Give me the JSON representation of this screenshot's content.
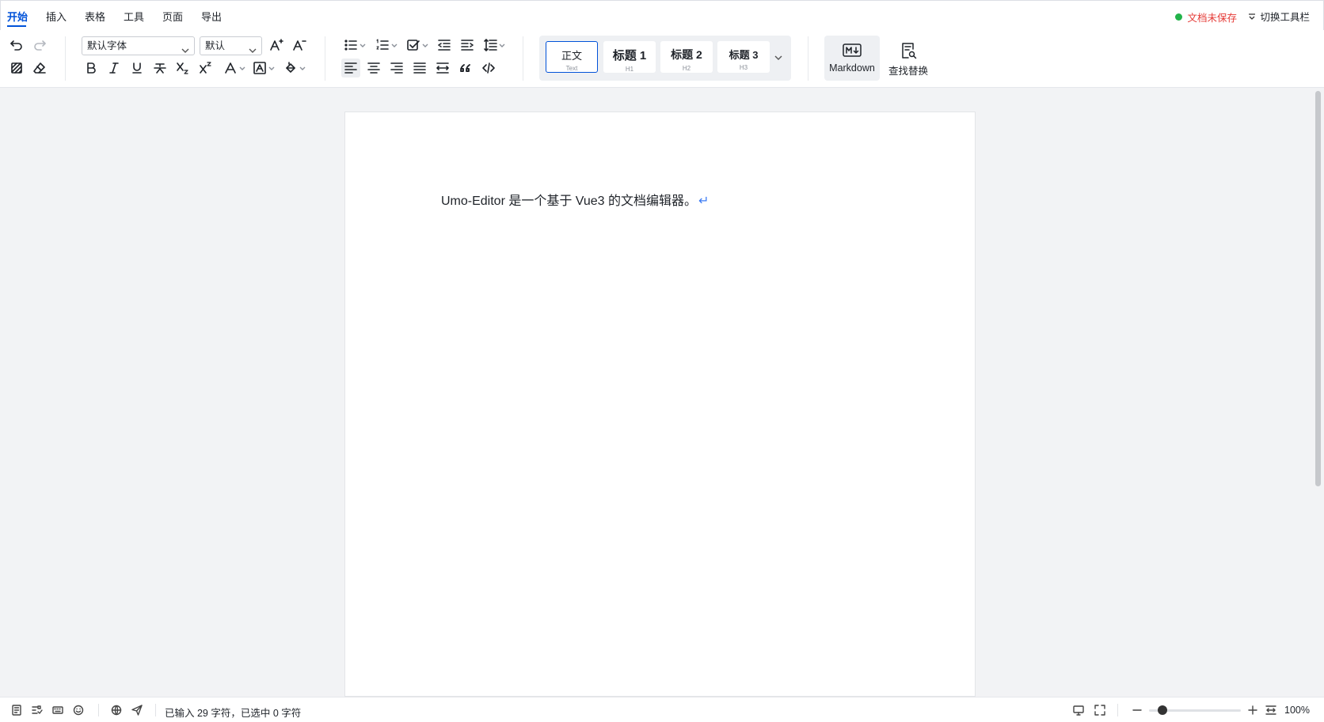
{
  "menu": {
    "tabs": [
      "开始",
      "插入",
      "表格",
      "工具",
      "页面",
      "导出"
    ],
    "active_tab": "开始",
    "save_status": "文档未保存",
    "toggle_toolbar": "切换工具栏"
  },
  "toolbar": {
    "font_family": "默认字体",
    "font_size": "默认",
    "styles": [
      {
        "main": "正文",
        "sub": "Text"
      },
      {
        "main": "标题 1",
        "sub": "H1"
      },
      {
        "main": "标题 2",
        "sub": "H2"
      },
      {
        "main": "标题 3",
        "sub": "H3"
      }
    ],
    "active_style": "正文",
    "markdown_label": "Markdown",
    "find_replace_label": "查找替换"
  },
  "document": {
    "paragraph": "Umo-Editor 是一个基于 Vue3 的文档编辑器。",
    "enter_mark": "↵"
  },
  "statusbar": {
    "word_count": "已输入 29 字符，已选中 0 字符",
    "zoom_label": "100%",
    "zoom_fraction": 0.15
  },
  "colors": {
    "accent": "#0052d9",
    "unsaved": "#e53935",
    "saved_dot": "#22b34a",
    "enter_mark": "#3d7cf4"
  }
}
